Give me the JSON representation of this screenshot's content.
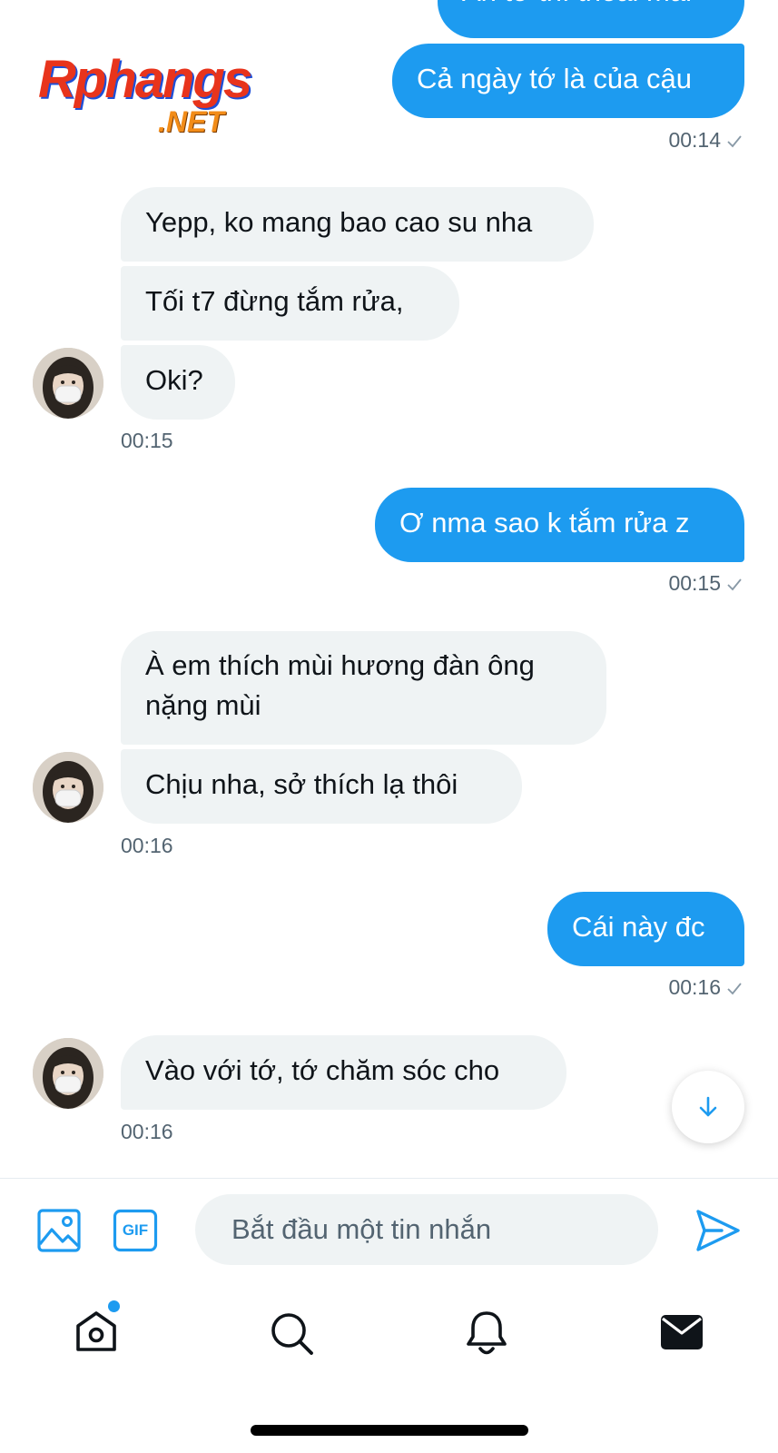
{
  "watermark": {
    "main": "Rphangs",
    "sub": ".NET"
  },
  "messages": {
    "out1_partial": "Ấn tớ thì thoải mái",
    "out2": "Cả ngày tớ là của cậu",
    "t1": "00:14",
    "in1": "Yepp, ko mang bao cao su nha",
    "in2": "Tối t7 đừng tắm rửa,",
    "in3": "Oki?",
    "t2": "00:15",
    "out3": "Ơ nma sao k tắm rửa z",
    "t3": "00:15",
    "in4": "À em thích mùi hương đàn ông nặng mùi",
    "in5": "Chịu nha, sở thích lạ thôi",
    "t4": "00:16",
    "out4": "Cái này đc",
    "t5": "00:16",
    "in6": "Vào với tớ, tớ chăm sóc cho",
    "t6": "00:16"
  },
  "composer": {
    "placeholder": "Bắt đầu một tin nhắn",
    "gif_label": "GIF"
  },
  "colors": {
    "accent": "#1d9bf0",
    "incoming_bubble": "#eff3f4",
    "secondary_text": "#536471"
  },
  "icons": {
    "media": "image-icon",
    "gif": "gif-icon",
    "send": "send-icon",
    "scroll": "arrow-down-icon",
    "home": "home-icon",
    "search": "search-icon",
    "notifications": "bell-icon",
    "messages": "mail-icon"
  }
}
